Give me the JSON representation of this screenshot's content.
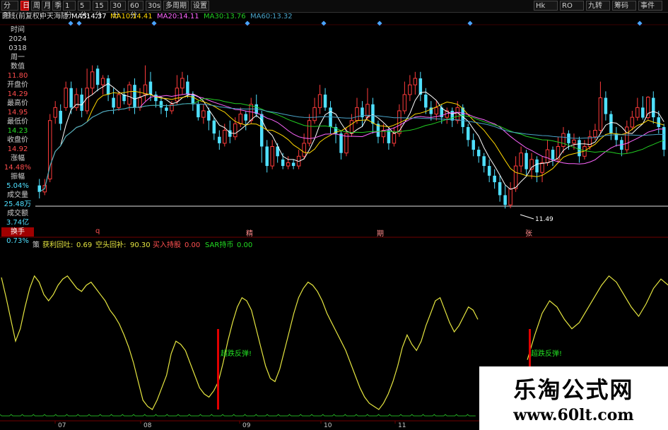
{
  "toolbar": {
    "buttons": [
      "分时",
      "日",
      "周",
      "月",
      "季",
      "1分",
      "5分",
      "15分",
      "30分",
      "60分",
      "30s",
      "多周期",
      "设置"
    ],
    "active_index": 1,
    "right_buttons": [
      "Hk",
      "RO",
      "九转",
      "筹码",
      "事件"
    ]
  },
  "info": {
    "chart_mode": "日线(前复权)",
    "stock_name": "中天海随",
    "ma5_label": "MA5:",
    "ma5": "14.37",
    "ma10_label": "MA10:",
    "ma10": "14.41",
    "ma20_label": "MA20:",
    "ma20": "14.11",
    "ma30_label": "MA30:",
    "ma30": "13.76",
    "ma60_label": "MA60:",
    "ma60": "13.32"
  },
  "left_panel": {
    "time_label": "时间",
    "year": "2024",
    "date": "0318",
    "weekday": "周一",
    "value_label": "数值",
    "value": "11.80",
    "open_label": "开盘价",
    "open": "14.29",
    "high_label": "最高价",
    "high": "14.95",
    "low_label": "最低价",
    "low": "14.23",
    "close_label": "收盘价",
    "close": "14.92",
    "change_label": "涨幅",
    "change": "14.48%",
    "amplitude_label": "振幅",
    "amplitude": "5.04%",
    "volume_label": "成交量",
    "volume": "25.48万",
    "amount_label": "成交额",
    "amount": "3.74亿",
    "turnover_label": "换手",
    "turnover": "0.73%"
  },
  "markers": {
    "q": "q",
    "m1": "精",
    "m2": "期",
    "m3": "张"
  },
  "low_annotation": "11.49",
  "indicator": {
    "name": "策",
    "l1_label": "获利回吐:",
    "l1": "0.69",
    "l2_label": "空头回补:",
    "l2": "90.30",
    "l3_label": "买入持股",
    "l3": "0.00",
    "l4_label": "SAR持币",
    "l4": "0.00"
  },
  "signals": {
    "s1": "超跌反弹!",
    "s2": "超跌反弹!"
  },
  "x_axis": {
    "labels": [
      "07",
      "08",
      "09",
      "10",
      "11"
    ]
  },
  "watermark": {
    "line1": "乐淘公式网",
    "line2": "www.60lt.com"
  },
  "colors": {
    "up": "#ff3b3b",
    "down": "#4fe0ff",
    "ma5": "#ffffff",
    "ma10": "#ffd700",
    "ma20": "#ff66ff",
    "ma30": "#22cc22",
    "ma60": "#4aa3c8",
    "indicator": "#e6e640"
  },
  "chart_data": {
    "type": "candlestick",
    "ma_lines": [
      {
        "name": "MA5",
        "value": 14.37
      },
      {
        "name": "MA10",
        "value": 14.41
      },
      {
        "name": "MA20",
        "value": 14.11
      },
      {
        "name": "MA30",
        "value": 13.76
      },
      {
        "name": "MA60",
        "value": 13.32
      }
    ],
    "candles": [
      {
        "o": 12.2,
        "c": 12.0,
        "h": 12.4,
        "l": 11.8
      },
      {
        "o": 12.0,
        "c": 12.2,
        "h": 12.4,
        "l": 11.9
      },
      {
        "o": 12.4,
        "c": 14.2,
        "h": 14.4,
        "l": 12.3
      },
      {
        "o": 14.3,
        "c": 14.6,
        "h": 14.8,
        "l": 14.1
      },
      {
        "o": 14.5,
        "c": 14.1,
        "h": 14.7,
        "l": 13.9
      },
      {
        "o": 14.6,
        "c": 15.2,
        "h": 15.4,
        "l": 14.5
      },
      {
        "o": 15.2,
        "c": 14.6,
        "h": 15.4,
        "l": 14.4
      },
      {
        "o": 14.6,
        "c": 15.0,
        "h": 15.2,
        "l": 14.5
      },
      {
        "o": 15.0,
        "c": 14.5,
        "h": 15.2,
        "l": 14.3
      },
      {
        "o": 14.5,
        "c": 15.2,
        "h": 15.8,
        "l": 14.4
      },
      {
        "o": 15.2,
        "c": 15.7,
        "h": 15.9,
        "l": 15.0
      },
      {
        "o": 15.8,
        "c": 15.3,
        "h": 15.9,
        "l": 15.1
      },
      {
        "o": 15.3,
        "c": 15.5,
        "h": 15.6,
        "l": 15.0
      },
      {
        "o": 15.5,
        "c": 15.0,
        "h": 15.6,
        "l": 14.8
      },
      {
        "o": 14.9,
        "c": 14.6,
        "h": 15.2,
        "l": 14.4
      },
      {
        "o": 14.6,
        "c": 15.0,
        "h": 15.1,
        "l": 14.5
      },
      {
        "o": 15.0,
        "c": 14.8,
        "h": 15.2,
        "l": 14.7
      },
      {
        "o": 14.7,
        "c": 15.3,
        "h": 15.4,
        "l": 14.5
      },
      {
        "o": 15.3,
        "c": 14.6,
        "h": 15.5,
        "l": 14.4
      },
      {
        "o": 14.6,
        "c": 14.9,
        "h": 15.2,
        "l": 14.5
      },
      {
        "o": 15.0,
        "c": 15.3,
        "h": 15.9,
        "l": 14.8
      },
      {
        "o": 15.4,
        "c": 15.0,
        "h": 15.7,
        "l": 14.8
      },
      {
        "o": 15.0,
        "c": 14.8,
        "h": 15.1,
        "l": 14.6
      },
      {
        "o": 14.8,
        "c": 14.6,
        "h": 14.9,
        "l": 14.4
      },
      {
        "o": 14.6,
        "c": 14.5,
        "h": 14.7,
        "l": 14.3
      },
      {
        "o": 14.5,
        "c": 14.7,
        "h": 14.8,
        "l": 14.4
      },
      {
        "o": 14.8,
        "c": 15.2,
        "h": 15.6,
        "l": 14.7
      },
      {
        "o": 15.2,
        "c": 15.5,
        "h": 15.7,
        "l": 15.0
      },
      {
        "o": 15.4,
        "c": 15.0,
        "h": 15.6,
        "l": 14.9
      },
      {
        "o": 15.0,
        "c": 14.7,
        "h": 15.1,
        "l": 14.5
      },
      {
        "o": 14.7,
        "c": 14.3,
        "h": 14.8,
        "l": 14.2
      },
      {
        "o": 14.3,
        "c": 14.5,
        "h": 14.7,
        "l": 14.1
      },
      {
        "o": 14.5,
        "c": 14.2,
        "h": 14.6,
        "l": 13.9
      },
      {
        "o": 14.2,
        "c": 13.8,
        "h": 14.3,
        "l": 13.6
      },
      {
        "o": 13.7,
        "c": 13.5,
        "h": 13.9,
        "l": 13.3
      },
      {
        "o": 13.5,
        "c": 13.9,
        "h": 14.1,
        "l": 13.4
      },
      {
        "o": 13.9,
        "c": 13.7,
        "h": 14.2,
        "l": 13.5
      },
      {
        "o": 13.7,
        "c": 14.1,
        "h": 14.3,
        "l": 13.6
      },
      {
        "o": 14.1,
        "c": 14.4,
        "h": 14.6,
        "l": 14.0
      },
      {
        "o": 14.4,
        "c": 14.2,
        "h": 14.5,
        "l": 13.9
      },
      {
        "o": 14.2,
        "c": 14.7,
        "h": 14.9,
        "l": 14.1
      },
      {
        "o": 14.7,
        "c": 14.4,
        "h": 15.0,
        "l": 14.3
      },
      {
        "o": 14.4,
        "c": 13.4,
        "h": 14.5,
        "l": 12.9
      },
      {
        "o": 13.4,
        "c": 12.8,
        "h": 13.6,
        "l": 12.6
      },
      {
        "o": 12.8,
        "c": 13.4,
        "h": 13.6,
        "l": 12.7
      },
      {
        "o": 13.4,
        "c": 13.1,
        "h": 13.5,
        "l": 12.9
      },
      {
        "o": 13.0,
        "c": 12.8,
        "h": 13.2,
        "l": 12.7
      },
      {
        "o": 12.8,
        "c": 12.9,
        "h": 13.1,
        "l": 12.7
      },
      {
        "o": 12.9,
        "c": 12.8,
        "h": 13.0,
        "l": 12.7
      },
      {
        "o": 12.8,
        "c": 13.1,
        "h": 13.3,
        "l": 12.7
      },
      {
        "o": 13.1,
        "c": 13.5,
        "h": 13.8,
        "l": 13.0
      },
      {
        "o": 13.5,
        "c": 14.2,
        "h": 14.4,
        "l": 13.4
      },
      {
        "o": 14.2,
        "c": 14.6,
        "h": 14.9,
        "l": 14.1
      },
      {
        "o": 14.6,
        "c": 15.0,
        "h": 15.3,
        "l": 14.4
      },
      {
        "o": 15.0,
        "c": 14.6,
        "h": 15.2,
        "l": 14.5
      },
      {
        "o": 14.6,
        "c": 14.0,
        "h": 14.8,
        "l": 13.8
      },
      {
        "o": 14.0,
        "c": 13.8,
        "h": 14.1,
        "l": 13.5
      },
      {
        "o": 13.8,
        "c": 13.2,
        "h": 13.9,
        "l": 13.0
      },
      {
        "o": 13.2,
        "c": 13.8,
        "h": 14.0,
        "l": 13.1
      },
      {
        "o": 13.8,
        "c": 14.2,
        "h": 14.4,
        "l": 13.7
      },
      {
        "o": 14.2,
        "c": 14.6,
        "h": 14.9,
        "l": 14.1
      },
      {
        "o": 14.6,
        "c": 14.3,
        "h": 14.8,
        "l": 14.0
      },
      {
        "o": 14.3,
        "c": 14.7,
        "h": 15.2,
        "l": 14.2
      },
      {
        "o": 14.7,
        "c": 14.1,
        "h": 14.9,
        "l": 13.8
      },
      {
        "o": 14.1,
        "c": 13.7,
        "h": 14.2,
        "l": 13.5
      },
      {
        "o": 13.7,
        "c": 13.9,
        "h": 14.1,
        "l": 13.5
      },
      {
        "o": 13.9,
        "c": 13.5,
        "h": 14.0,
        "l": 13.3
      },
      {
        "o": 13.5,
        "c": 13.8,
        "h": 14.0,
        "l": 13.4
      },
      {
        "o": 13.8,
        "c": 14.5,
        "h": 14.7,
        "l": 13.7
      },
      {
        "o": 14.5,
        "c": 15.0,
        "h": 15.4,
        "l": 14.4
      },
      {
        "o": 15.0,
        "c": 15.3,
        "h": 15.6,
        "l": 14.8
      },
      {
        "o": 15.3,
        "c": 15.5,
        "h": 15.7,
        "l": 15.0
      },
      {
        "o": 15.5,
        "c": 15.0,
        "h": 15.7,
        "l": 14.8
      },
      {
        "o": 15.0,
        "c": 14.6,
        "h": 15.2,
        "l": 14.4
      },
      {
        "o": 14.6,
        "c": 14.4,
        "h": 14.8,
        "l": 14.2
      },
      {
        "o": 14.4,
        "c": 14.6,
        "h": 14.8,
        "l": 14.2
      },
      {
        "o": 14.6,
        "c": 14.3,
        "h": 14.7,
        "l": 14.1
      },
      {
        "o": 14.3,
        "c": 14.5,
        "h": 14.6,
        "l": 14.1
      },
      {
        "o": 14.5,
        "c": 14.2,
        "h": 14.6,
        "l": 14.0
      },
      {
        "o": 14.2,
        "c": 14.6,
        "h": 14.8,
        "l": 14.1
      },
      {
        "o": 14.6,
        "c": 14.0,
        "h": 14.7,
        "l": 13.8
      },
      {
        "o": 14.0,
        "c": 13.6,
        "h": 14.1,
        "l": 13.4
      },
      {
        "o": 13.6,
        "c": 13.3,
        "h": 13.8,
        "l": 13.1
      },
      {
        "o": 13.3,
        "c": 13.1,
        "h": 13.4,
        "l": 12.9
      },
      {
        "o": 13.1,
        "c": 12.8,
        "h": 13.2,
        "l": 12.6
      },
      {
        "o": 12.8,
        "c": 12.5,
        "h": 13.0,
        "l": 12.3
      },
      {
        "o": 12.5,
        "c": 12.3,
        "h": 12.7,
        "l": 12.1
      },
      {
        "o": 12.3,
        "c": 11.9,
        "h": 12.5,
        "l": 11.7
      },
      {
        "o": 11.9,
        "c": 11.6,
        "h": 12.2,
        "l": 11.49
      },
      {
        "o": 11.6,
        "c": 12.1,
        "h": 12.3,
        "l": 11.5
      },
      {
        "o": 12.1,
        "c": 12.8,
        "h": 13.1,
        "l": 12.0
      },
      {
        "o": 12.8,
        "c": 13.2,
        "h": 13.4,
        "l": 12.6
      },
      {
        "o": 13.2,
        "c": 12.7,
        "h": 13.3,
        "l": 12.5
      },
      {
        "o": 12.7,
        "c": 13.0,
        "h": 13.2,
        "l": 12.4
      },
      {
        "o": 13.0,
        "c": 12.6,
        "h": 13.1,
        "l": 12.3
      },
      {
        "o": 12.6,
        "c": 12.9,
        "h": 13.1,
        "l": 12.3
      },
      {
        "o": 12.9,
        "c": 13.3,
        "h": 13.6,
        "l": 12.8
      },
      {
        "o": 13.3,
        "c": 13.0,
        "h": 13.4,
        "l": 12.8
      },
      {
        "o": 13.0,
        "c": 13.4,
        "h": 13.7,
        "l": 12.9
      },
      {
        "o": 13.4,
        "c": 13.8,
        "h": 14.0,
        "l": 13.2
      },
      {
        "o": 13.8,
        "c": 13.5,
        "h": 13.9,
        "l": 13.3
      },
      {
        "o": 13.5,
        "c": 13.6,
        "h": 13.8,
        "l": 13.3
      },
      {
        "o": 13.6,
        "c": 13.1,
        "h": 13.7,
        "l": 12.9
      },
      {
        "o": 13.1,
        "c": 13.4,
        "h": 13.6,
        "l": 13.0
      },
      {
        "o": 13.4,
        "c": 13.7,
        "h": 13.9,
        "l": 13.3
      },
      {
        "o": 13.7,
        "c": 13.9,
        "h": 14.1,
        "l": 13.6
      },
      {
        "o": 13.9,
        "c": 14.9,
        "h": 15.4,
        "l": 13.8
      },
      {
        "o": 14.9,
        "c": 14.4,
        "h": 15.1,
        "l": 14.2
      },
      {
        "o": 14.4,
        "c": 13.8,
        "h": 14.5,
        "l": 13.6
      },
      {
        "o": 13.8,
        "c": 13.6,
        "h": 14.0,
        "l": 13.4
      },
      {
        "o": 13.6,
        "c": 13.3,
        "h": 13.7,
        "l": 13.1
      },
      {
        "o": 13.3,
        "c": 14.0,
        "h": 14.2,
        "l": 13.2
      },
      {
        "o": 14.0,
        "c": 14.3,
        "h": 14.5,
        "l": 13.9
      },
      {
        "o": 14.3,
        "c": 14.6,
        "h": 14.9,
        "l": 14.2
      },
      {
        "o": 14.6,
        "c": 14.29,
        "h": 14.95,
        "l": 14.23
      },
      {
        "o": 14.29,
        "c": 14.92,
        "h": 14.95,
        "l": 14.23
      },
      {
        "o": 14.9,
        "c": 14.3,
        "h": 15.1,
        "l": 14.1
      },
      {
        "o": 14.3,
        "c": 14.0,
        "h": 14.5,
        "l": 13.8
      },
      {
        "o": 14.0,
        "c": 13.3,
        "h": 14.1,
        "l": 13.1
      }
    ],
    "indicator_series": {
      "name": "策",
      "values": [
        85,
        72,
        58,
        44,
        52,
        66,
        78,
        86,
        82,
        74,
        70,
        74,
        80,
        84,
        86,
        82,
        78,
        76,
        80,
        82,
        78,
        74,
        70,
        64,
        60,
        55,
        48,
        40,
        30,
        18,
        6,
        2,
        0,
        6,
        14,
        22,
        36,
        44,
        42,
        38,
        30,
        22,
        14,
        10,
        8,
        12,
        18,
        30,
        44,
        56,
        66,
        72,
        70,
        64,
        52,
        40,
        28,
        20,
        18,
        26,
        38,
        50,
        62,
        72,
        78,
        82,
        80,
        76,
        70,
        62,
        56,
        50,
        44,
        38,
        30,
        22,
        14,
        8,
        4,
        2,
        0,
        4,
        10,
        18,
        28,
        40,
        48,
        42,
        38,
        44,
        54,
        62,
        70,
        72,
        64,
        56,
        50,
        54,
        60,
        66,
        64,
        58
      ]
    },
    "xlabels": [
      "07",
      "08",
      "09",
      "10",
      "11"
    ]
  }
}
